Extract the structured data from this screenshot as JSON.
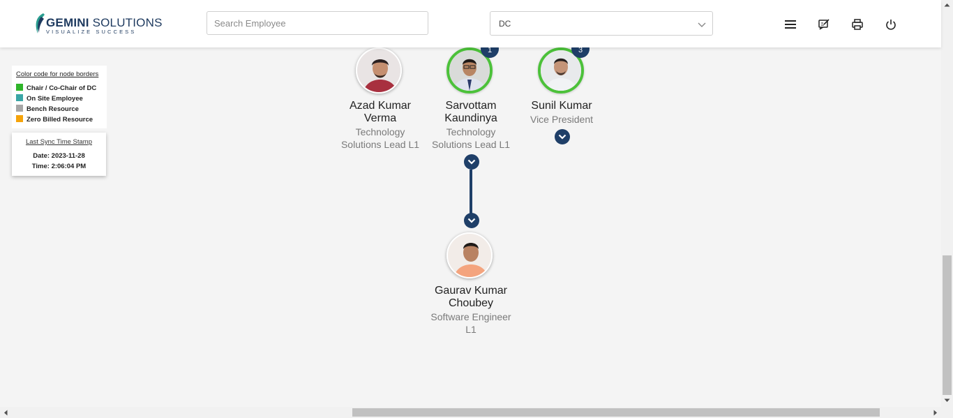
{
  "header": {
    "logo_main_bold": "GEMINI",
    "logo_main": " SOLUTIONS",
    "logo_tagline": "VISUALIZE SUCCESS",
    "search_placeholder": "Search Employee",
    "department_selected": "DC",
    "icons": [
      "menu-icon",
      "feedback-icon",
      "print-icon",
      "power-icon"
    ]
  },
  "legend": {
    "title": "Color code for node borders",
    "items": [
      {
        "label": "Chair / Co-Chair of DC",
        "color": "#2fb52a"
      },
      {
        "label": "On Site Employee",
        "color": "#3aa6a6"
      },
      {
        "label": "Bench Resource",
        "color": "#a6a6a6"
      },
      {
        "label": "Zero Billed Resource",
        "color": "#f5a30a"
      }
    ]
  },
  "sync": {
    "title": "Last Sync Time Stamp",
    "date": "Date: 2023-11-28",
    "time": "Time: 2:06:04 PM"
  },
  "nodes": [
    {
      "name_line1": "Azad Kumar",
      "name_line2": "Verma",
      "role_line1": "Technology",
      "role_line2": "Solutions Lead L1",
      "badge": ""
    },
    {
      "name_line1": "Sarvottam",
      "name_line2": "Kaundinya",
      "role_line1": "Technology",
      "role_line2": "Solutions Lead L1",
      "badge": "1"
    },
    {
      "name_line1": "Sunil Kumar",
      "name_line2": "",
      "role_line1": "Vice President",
      "role_line2": "",
      "badge": "3"
    },
    {
      "name_line1": "Gaurav Kumar",
      "name_line2": "Choubey",
      "role_line1": "Software Engineer",
      "role_line2": "L1",
      "badge": ""
    }
  ],
  "colors": {
    "accent": "#1f3f68",
    "chair_border": "#4cc13a"
  }
}
